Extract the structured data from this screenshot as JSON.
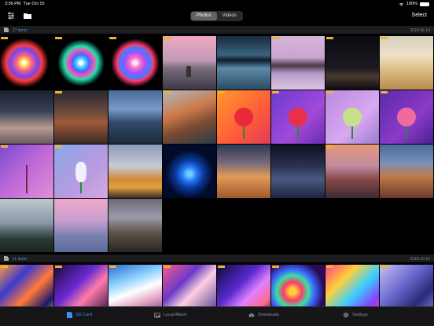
{
  "status": {
    "time": "3:56 PM",
    "date": "Tue Oct 15",
    "battery": "100%"
  },
  "nav": {
    "segments": [
      "Photos",
      "Videos"
    ],
    "active_segment": "Photos",
    "select_label": "Select"
  },
  "sections": [
    {
      "count": "27 items",
      "date": "2018-06-14"
    },
    {
      "count": "11 items",
      "date": "2018-10-12"
    }
  ],
  "tabs": [
    {
      "label": "SD Card",
      "icon": "sd-card-icon",
      "active": true
    },
    {
      "label": "Local Album",
      "icon": "photo-album-icon",
      "active": false
    },
    {
      "label": "Downloads",
      "icon": "cloud-download-icon",
      "active": false
    },
    {
      "label": "Settings",
      "icon": "gear-icon",
      "active": false
    }
  ],
  "colors": {
    "accent": "#3a8ef0",
    "badge": "#f0b429",
    "background": "#000000"
  }
}
